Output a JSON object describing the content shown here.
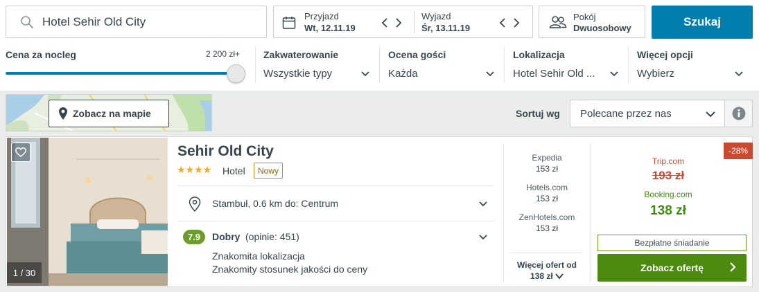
{
  "search": {
    "query": "Hotel Sehir Old City",
    "checkin_label": "Przyjazd",
    "checkin_value": "Wt, 12.11.19",
    "checkout_label": "Wyjazd",
    "checkout_value": "Śr, 13.11.19",
    "room_label": "Pokój",
    "room_value": "Dwuosobowy",
    "submit_label": "Szukaj"
  },
  "filters": {
    "price": {
      "title": "Cena za nocleg",
      "max_value": "2 200 zł+",
      "slider_level_percent": 100
    },
    "accommodation": {
      "title": "Zakwaterowanie",
      "value": "Wszystkie typy"
    },
    "rating": {
      "title": "Ocena gości",
      "value": "Każda"
    },
    "location": {
      "title": "Lokalizacja",
      "value": "Hotel Sehir Old ..."
    },
    "more": {
      "title": "Więcej opcji",
      "value": "Wybierz"
    }
  },
  "toolbar": {
    "map_button_label": "Zobacz na mapie",
    "sort_label": "Sortuj wg",
    "sort_value": "Polecane przez nas"
  },
  "hotel": {
    "name": "Sehir Old City",
    "stars": "★★★★",
    "star_count": 4,
    "type": "Hotel",
    "new_badge": "Nowy",
    "photo_counter": "1 / 30",
    "location": "Stambuł, 0.6 km do: Centrum",
    "rating_score": "7.9",
    "rating_word": "Dobry",
    "rating_count": "(opinie: 451)",
    "highlights": [
      "Znakomita lokalizacja",
      "Znakomity stosunek jakości do ceny"
    ],
    "other_offers": [
      {
        "provider": "Expedia",
        "price": "153 zł"
      },
      {
        "provider": "Hotels.com",
        "price": "153 zł"
      },
      {
        "provider": "ZenHotels.com",
        "price": "153 zł"
      }
    ],
    "more_offers_label": "Więcej ofert od",
    "more_offers_price": "138 zł",
    "discount": "-28%",
    "original_site": "Trip.com",
    "original_price": "193 zł",
    "best_site": "Booking.com",
    "best_price": "138 zł",
    "perk": "Bezpłatne śniadanie",
    "cta_label": "Zobacz ofertę"
  },
  "colors": {
    "primary_blue": "#007faf",
    "deal_green": "#4c8b0f",
    "rating_green": "#6c9e2a",
    "discount_red": "#c94a30"
  }
}
